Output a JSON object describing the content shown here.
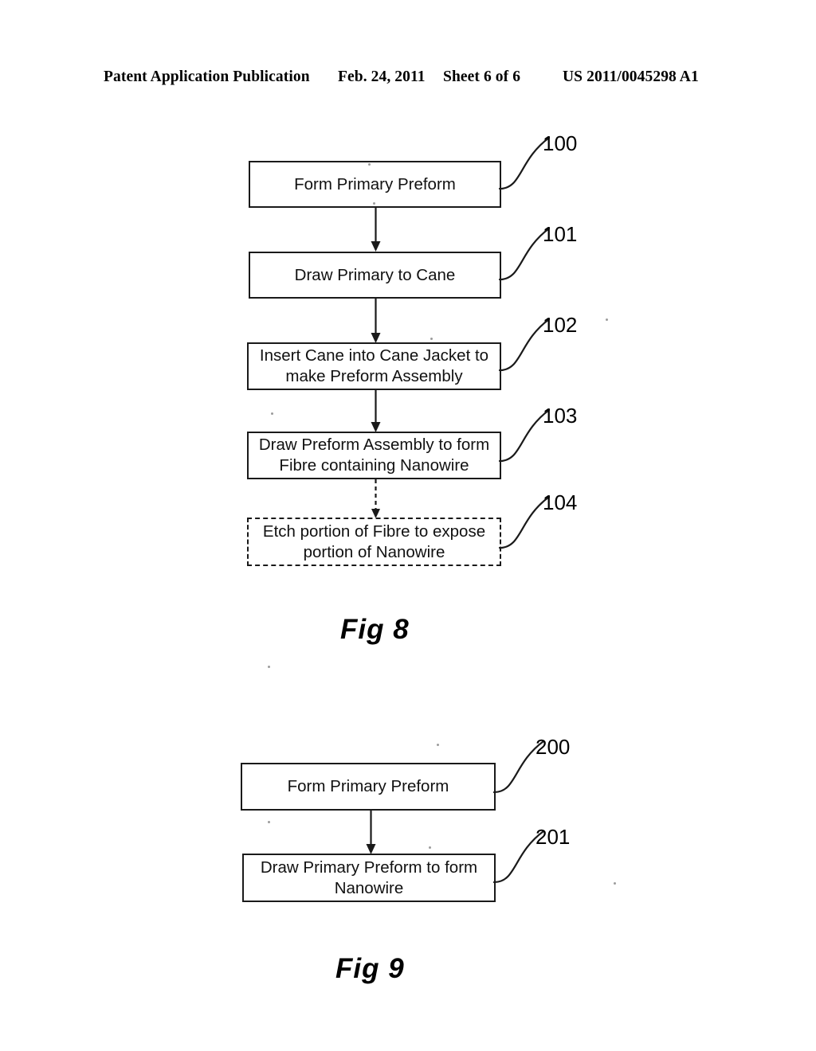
{
  "header": {
    "publication": "Patent Application Publication",
    "date": "Feb. 24, 2011",
    "sheet": "Sheet 6 of 6",
    "patent_number": "US 2011/0045298 A1"
  },
  "figures": [
    {
      "caption": "Fig 8",
      "type": "flowchart",
      "steps": [
        {
          "ref": "100",
          "label": "Form Primary Preform",
          "border": "solid",
          "incoming_arrow": "none"
        },
        {
          "ref": "101",
          "label": "Draw Primary to Cane",
          "border": "solid",
          "incoming_arrow": "solid"
        },
        {
          "ref": "102",
          "label": "Insert Cane into Cane Jacket to make Preform Assembly",
          "label_line_1": "Insert Cane into Cane Jacket to",
          "label_line_2": "make Preform Assembly",
          "border": "solid",
          "incoming_arrow": "solid"
        },
        {
          "ref": "103",
          "label": "Draw Preform Assembly to form Fibre containing Nanowire",
          "label_line_1": "Draw Preform Assembly to form",
          "label_line_2": "Fibre containing Nanowire",
          "border": "solid",
          "incoming_arrow": "solid"
        },
        {
          "ref": "104",
          "label": "Etch portion of Fibre to expose portion of Nanowire",
          "label_line_1": "Etch portion of Fibre to expose",
          "label_line_2": "portion of Nanowire",
          "border": "dashed",
          "incoming_arrow": "dashed"
        }
      ]
    },
    {
      "caption": "Fig 9",
      "type": "flowchart",
      "steps": [
        {
          "ref": "200",
          "label": "Form Primary Preform",
          "border": "solid",
          "incoming_arrow": "none"
        },
        {
          "ref": "201",
          "label": "Draw Primary Preform to form Nanowire",
          "label_line_1": "Draw Primary Preform to form",
          "label_line_2": "Nanowire",
          "border": "solid",
          "incoming_arrow": "solid"
        }
      ]
    }
  ],
  "colors": {
    "ink": "#1a1a1a",
    "page_background": "#ffffff"
  }
}
